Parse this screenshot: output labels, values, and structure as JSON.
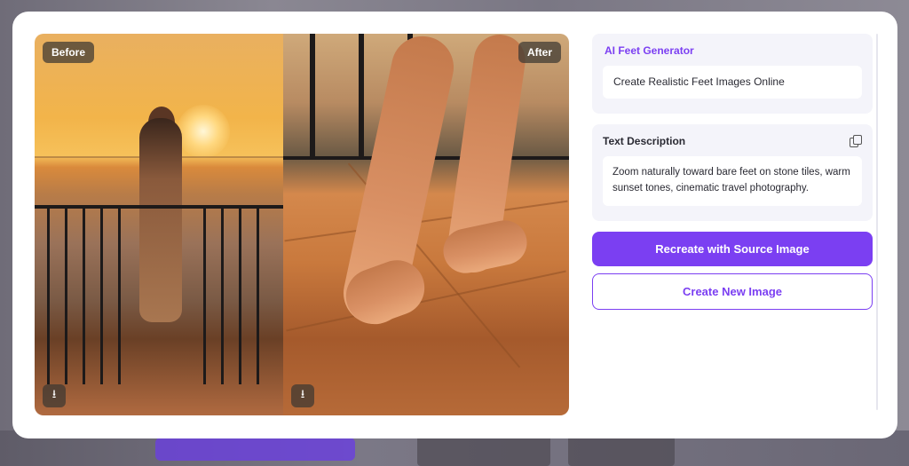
{
  "comparison": {
    "before_label": "Before",
    "after_label": "After",
    "download_icon_glyph": "⭳"
  },
  "generator": {
    "title": "AI Feet Generator",
    "headline": "Create Realistic Feet Images Online"
  },
  "description": {
    "title": "Text Description",
    "text": "Zoom naturally toward bare feet on stone tiles, warm sunset tones, cinematic travel photography."
  },
  "actions": {
    "recreate_label": "Recreate with Source Image",
    "create_new_label": "Create New Image"
  },
  "colors": {
    "accent": "#7b3ff2",
    "card_bg": "#f4f4fa"
  }
}
